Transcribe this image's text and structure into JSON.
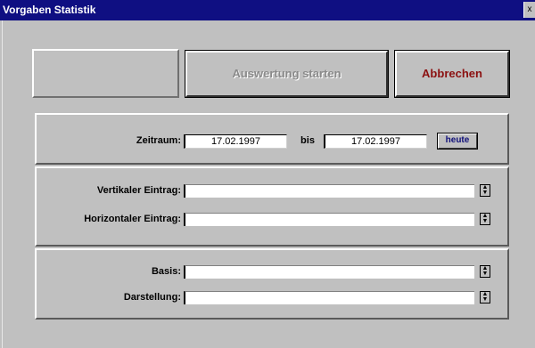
{
  "window": {
    "title": "Vorgaben Statistik",
    "close_glyph": "x"
  },
  "toolbar": {
    "start_label": "Auswertung starten",
    "cancel_label": "Abbrechen"
  },
  "period": {
    "label": "Zeitraum:",
    "from_value": "17.02.1997",
    "to_label": "bis",
    "to_value": "17.02.1997",
    "today_label": "heute"
  },
  "entries": {
    "vertical_label": "Vertikaler Eintrag:",
    "vertical_value": "",
    "horizontal_label": "Horizontaler Eintrag:",
    "horizontal_value": ""
  },
  "output": {
    "basis_label": "Basis:",
    "basis_value": "",
    "display_label": "Darstellung:",
    "display_value": ""
  },
  "colors": {
    "titlebar": "#0f0f82",
    "face": "#c0c0c0",
    "cancel_text": "#8b1010"
  },
  "icons": {
    "dropdown": "dropdown-arrow-icon"
  }
}
